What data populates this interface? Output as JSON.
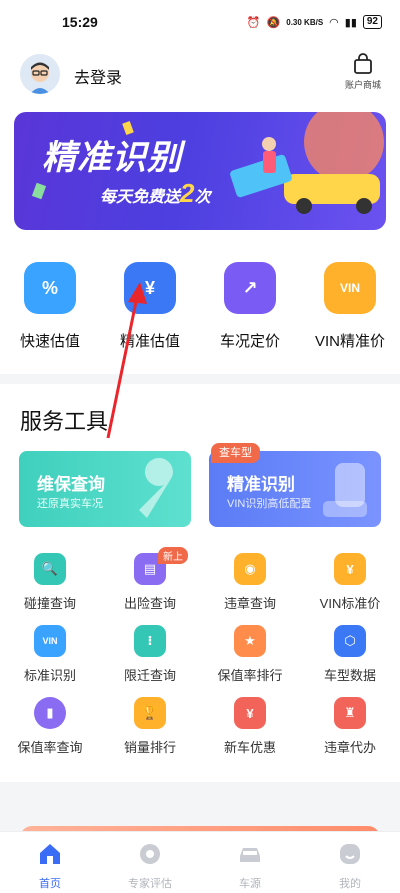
{
  "status_bar": {
    "time": "15:29",
    "speed": "0.30 KB/S",
    "battery": "92"
  },
  "header": {
    "login": "去登录",
    "shop": "账户商城"
  },
  "banner": {
    "title": "精准识别",
    "subtitle_prefix": "每天免费送",
    "subtitle_num": "2",
    "subtitle_suffix": "次"
  },
  "quick": [
    {
      "label": "快速估值",
      "glyph": "%",
      "color": "#3aa3ff"
    },
    {
      "label": "精准估值",
      "glyph": "¥",
      "color": "#3b78f6"
    },
    {
      "label": "车况定价",
      "glyph": "↗",
      "color": "#7a5cf4"
    },
    {
      "label": "VIN精准价",
      "glyph": "VIN",
      "color": "#ffb12b"
    }
  ],
  "services": {
    "title": "服务工具",
    "card_left": {
      "title": "维保查询",
      "sub": "还原真实车况"
    },
    "card_right": {
      "title": "精准识别",
      "sub": "VIN识别高低配置",
      "badge": "查车型"
    },
    "tools": [
      {
        "label": "碰撞查询",
        "color": "#35c7b5"
      },
      {
        "label": "出险查询",
        "color": "#8a6cf2",
        "badge": "新上"
      },
      {
        "label": "违章查询",
        "color": "#ffb12b"
      },
      {
        "label": "VIN标准价",
        "color": "#ffb12b"
      },
      {
        "label": "标准识别",
        "color": "#3aa3ff"
      },
      {
        "label": "限迁查询",
        "color": "#35c7b5"
      },
      {
        "label": "保值率排行",
        "color": "#ff8c4a"
      },
      {
        "label": "车型数据",
        "color": "#3b78f6"
      },
      {
        "label": "保值率查询",
        "color": "#8a6cf2"
      },
      {
        "label": "销量排行",
        "color": "#ffb12b"
      },
      {
        "label": "新车优惠",
        "color": "#f2645a"
      },
      {
        "label": "违章代办",
        "color": "#f2645a"
      }
    ]
  },
  "nav": [
    {
      "label": "首页",
      "active": true
    },
    {
      "label": "专家评估",
      "active": false
    },
    {
      "label": "车源",
      "active": false
    },
    {
      "label": "我的",
      "active": false
    }
  ],
  "colors": {
    "accent": "#3b6cf6",
    "arrow": "#e8262b"
  }
}
